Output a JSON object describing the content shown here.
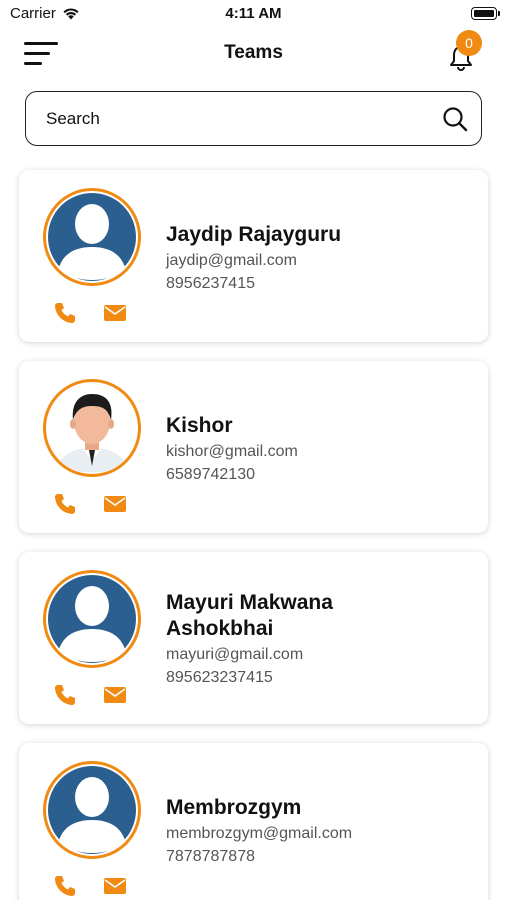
{
  "status_bar": {
    "carrier": "Carrier",
    "time": "4:11 AM"
  },
  "nav": {
    "title": "Teams",
    "notification_count": "0"
  },
  "search": {
    "placeholder": "Search"
  },
  "colors": {
    "accent": "#f08a13",
    "avatar_blue": "#2b5f8f"
  },
  "members": [
    {
      "name": "Jaydip Rajayguru",
      "email": "jaydip@gmail.com",
      "phone": "8956237415",
      "avatar": "default-avatar-icon"
    },
    {
      "name": "Kishor",
      "email": "kishor@gmail.com",
      "phone": "6589742130",
      "avatar": "person-photo-avatar"
    },
    {
      "name": "Mayuri Makwana Ashokbhai",
      "email": "mayuri@gmail.com",
      "phone": "895623237415",
      "avatar": "default-avatar-icon"
    },
    {
      "name": "Membrozgym",
      "email": "membrozgym@gmail.com",
      "phone": "7878787878",
      "avatar": "default-avatar-icon"
    }
  ]
}
